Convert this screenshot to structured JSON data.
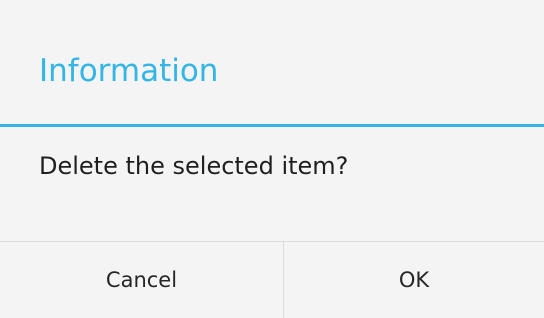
{
  "dialog": {
    "title": "Information",
    "message": "Delete the selected item?",
    "buttons": {
      "cancel_label": "Cancel",
      "ok_label": "OK"
    },
    "colors": {
      "accent": "#33b5e5",
      "background": "#f4f4f4",
      "text": "#1f1f1f",
      "divider": "#dcdcdc"
    }
  }
}
